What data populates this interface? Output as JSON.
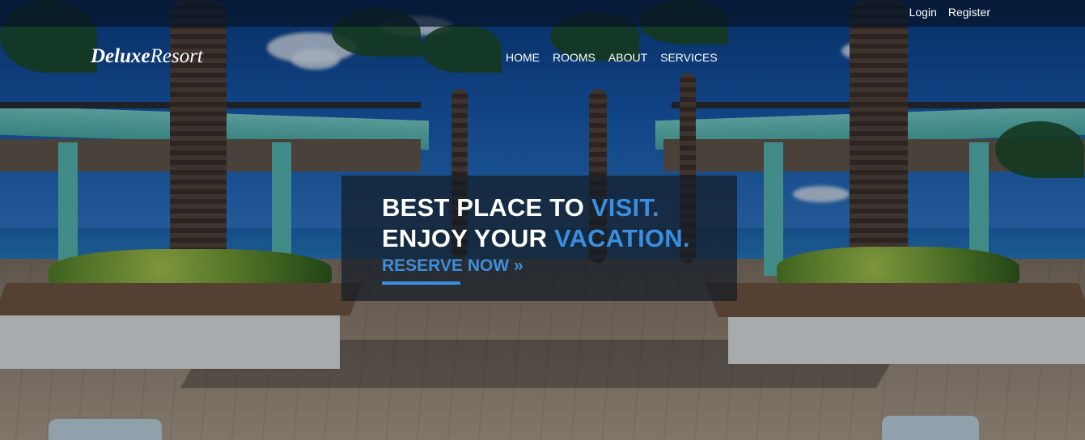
{
  "topbar": {
    "login": "Login",
    "register": "Register"
  },
  "brand": {
    "part1": "Deluxe",
    "part2": "Resort"
  },
  "nav": {
    "items": [
      "HOME",
      "ROOMS",
      "ABOUT",
      "SERVICES"
    ]
  },
  "hero": {
    "line1_main": "BEST PLACE TO ",
    "line1_accent": "VISIT.",
    "line2_main": "ENJOY YOUR ",
    "line2_accent": "VACATION.",
    "cta": "RESERVE NOW",
    "cta_icon": "»"
  },
  "colors": {
    "accent": "#3a8ee0",
    "topbar": "#05142b",
    "hero_box": "#141c26"
  }
}
